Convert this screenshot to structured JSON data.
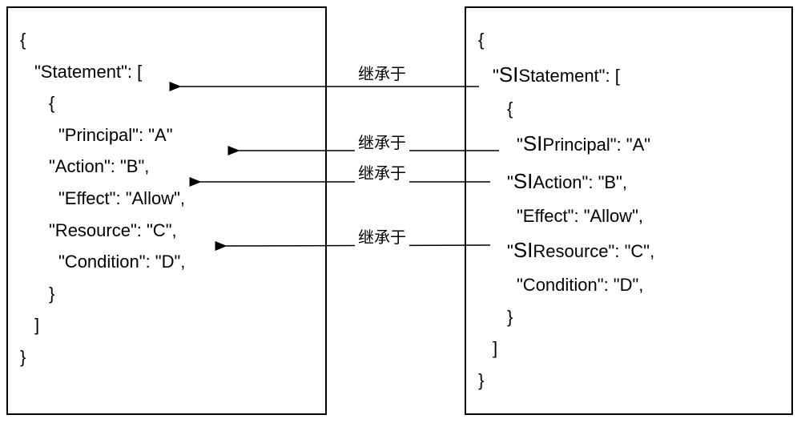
{
  "left": {
    "l0": "{",
    "l1": "\"Statement\": [",
    "l2": "{",
    "l3": "\"Principal\":  \"A\"",
    "l4": "\"Action\": \"B\",",
    "l5": "\"Effect\": \"Allow\",",
    "l6": "\"Resource\": \"C\",",
    "l7": "\"Condition\":  \"D\",",
    "l8": "}",
    "l9": "]",
    "l10": "}"
  },
  "right": {
    "prefix": "SI",
    "l0": "{",
    "l1_a": "\"",
    "l1_b": "Statement\": [",
    "l2": "{",
    "l3_a": "\"",
    "l3_b": "Principal\":  \"A\"",
    "l4_a": "\"",
    "l4_b": "Action\": \"B\",",
    "l5": "\"Effect\": \"Allow\",",
    "l6_a": "\"",
    "l6_b": "Resource\": \"C\",",
    "l7": "\"Condition\":  \"D\",",
    "l8": "}",
    "l9": "]",
    "l10": "}"
  },
  "arrows": {
    "label_statement": "继承于",
    "label_principal": "继承于",
    "label_action": "继承于",
    "label_resource": "继承于"
  },
  "chart_data": {
    "type": "diagram",
    "title": "",
    "description": "Two JSON-like policy objects side by side. Right side keys with SI prefix inherit from corresponding left side keys, shown by arrows labelled 继承于 (inherits from).",
    "left_object": {
      "Statement": [
        {
          "Principal": "A",
          "Action": "B",
          "Effect": "Allow",
          "Resource": "C",
          "Condition": "D"
        }
      ]
    },
    "right_object": {
      "SIStatement": [
        {
          "SIPrincipal": "A",
          "SIAction": "B",
          "Effect": "Allow",
          "SIResource": "C",
          "Condition": "D"
        }
      ]
    },
    "inheritance_edges": [
      {
        "from": "SIStatement",
        "to": "Statement",
        "label": "继承于"
      },
      {
        "from": "SIPrincipal",
        "to": "Principal",
        "label": "继承于"
      },
      {
        "from": "SIAction",
        "to": "Action",
        "label": "继承于"
      },
      {
        "from": "SIResource",
        "to": "Resource",
        "label": "继承于"
      }
    ]
  }
}
